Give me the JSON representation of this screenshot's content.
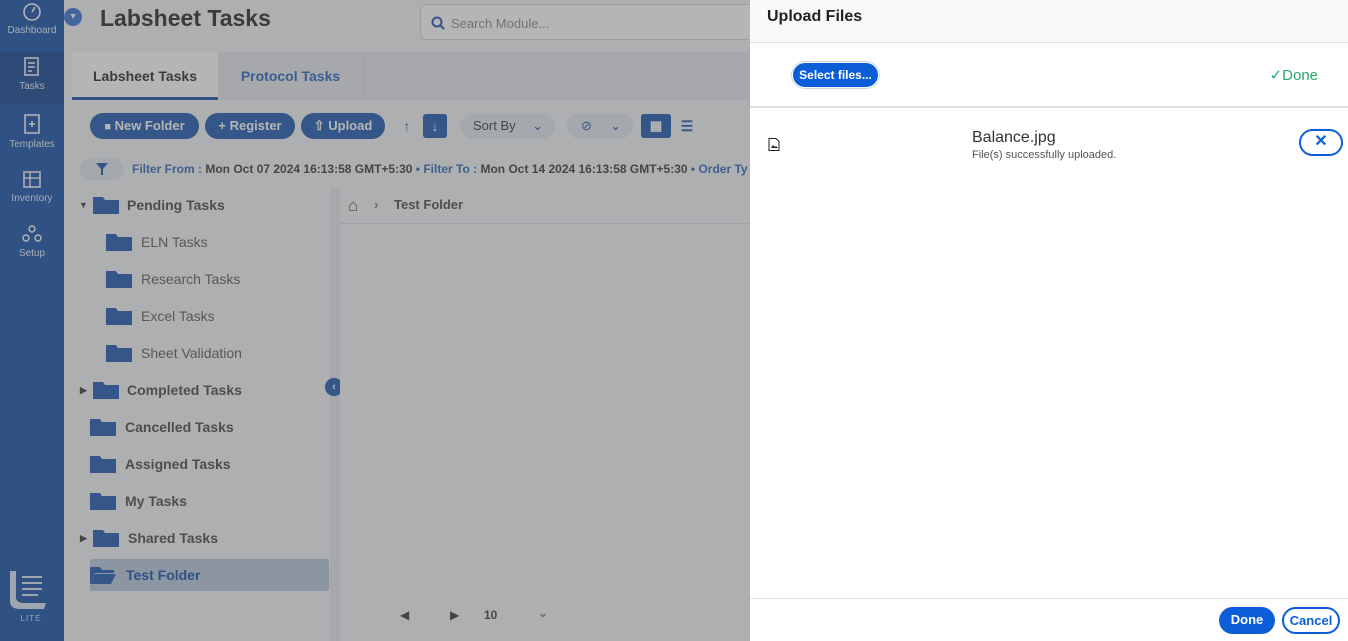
{
  "nav": {
    "items": [
      {
        "label": "Dashboard",
        "icon": "dashboard-icon"
      },
      {
        "label": "Tasks",
        "icon": "tasks-icon"
      },
      {
        "label": "Templates",
        "icon": "templates-icon"
      },
      {
        "label": "Inventory",
        "icon": "inventory-icon"
      },
      {
        "label": "Setup",
        "icon": "setup-icon"
      }
    ],
    "logo_text": "LITE"
  },
  "header": {
    "title": "Labsheet Tasks",
    "search_placeholder": "Search Module..."
  },
  "tabs": [
    {
      "label": "Labsheet Tasks"
    },
    {
      "label": "Protocol Tasks"
    }
  ],
  "toolbar": {
    "new_folder": "New Folder",
    "register": "Register",
    "upload": "Upload",
    "sort_by": "Sort By"
  },
  "filter": {
    "from_label": "Filter From :",
    "from_value": "Mon Oct 07 2024 16:13:58 GMT+5:30",
    "to_label": "Filter To :",
    "to_value": "Mon Oct 14 2024 16:13:58 GMT+5:30",
    "order_label": "Order Ty"
  },
  "tree": [
    {
      "label": "Pending Tasks"
    },
    {
      "label": "ELN Tasks"
    },
    {
      "label": "Research Tasks"
    },
    {
      "label": "Excel Tasks"
    },
    {
      "label": "Sheet Validation"
    },
    {
      "label": "Completed Tasks"
    },
    {
      "label": "Cancelled Tasks"
    },
    {
      "label": "Assigned Tasks"
    },
    {
      "label": "My Tasks"
    },
    {
      "label": "Shared Tasks"
    },
    {
      "label": "Test Folder"
    }
  ],
  "breadcrumb": {
    "current": "Test Folder"
  },
  "pager": {
    "page_size": "10"
  },
  "upload_panel": {
    "title": "Upload Files",
    "select_label": "Select files...",
    "done_top": "Done",
    "file": {
      "name": "Balance.jpg",
      "status": "File(s) successfully uploaded."
    },
    "done": "Done",
    "cancel": "Cancel"
  },
  "colors": {
    "nav": "#0b4aa6",
    "primary": "#0b5ed7",
    "success": "#2aa76b"
  }
}
